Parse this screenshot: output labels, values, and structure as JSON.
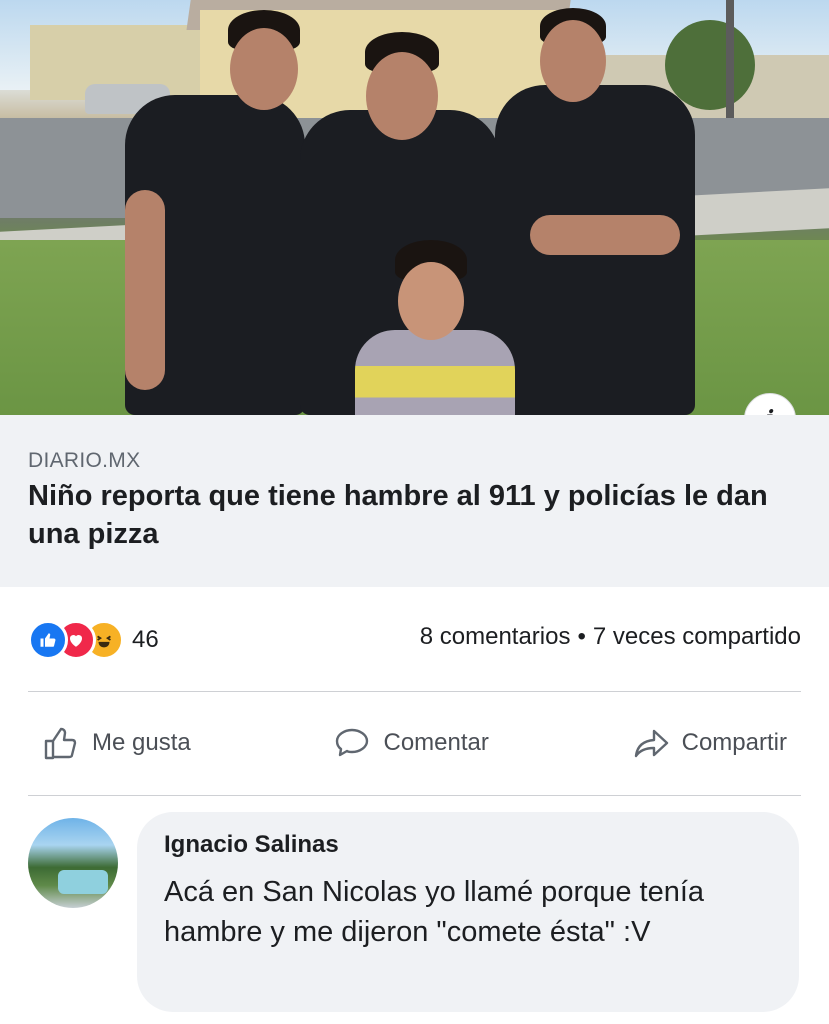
{
  "post": {
    "photo_alt": "",
    "info_label": "i",
    "link": {
      "source": "DIARIO.MX",
      "headline": "Niño reporta que tiene hambre al 911 y policías le dan una pizza"
    },
    "reactions": {
      "types": [
        "like",
        "love",
        "haha"
      ],
      "icons": [
        "👍",
        "❤",
        "😆"
      ],
      "count": "46"
    },
    "stats": {
      "comments": "8 comentarios",
      "separator": "•",
      "shares": "7 veces compartido"
    },
    "actions": {
      "like_label": "Me gusta",
      "comment_label": "Comentar",
      "share_label": "Compartir"
    },
    "comment": {
      "author": "Ignacio Salinas",
      "text": "Acá en San Nicolas yo llamé porque tenía hambre y me dijeron \"comete ésta\" :V"
    }
  },
  "colors": {
    "like_blue": "#1877f2",
    "love_red": "#f0284a",
    "haha_yellow": "#f7b125",
    "caption_bg": "#f0f2f5",
    "text_primary": "#1c1e21",
    "text_secondary": "#606770"
  }
}
